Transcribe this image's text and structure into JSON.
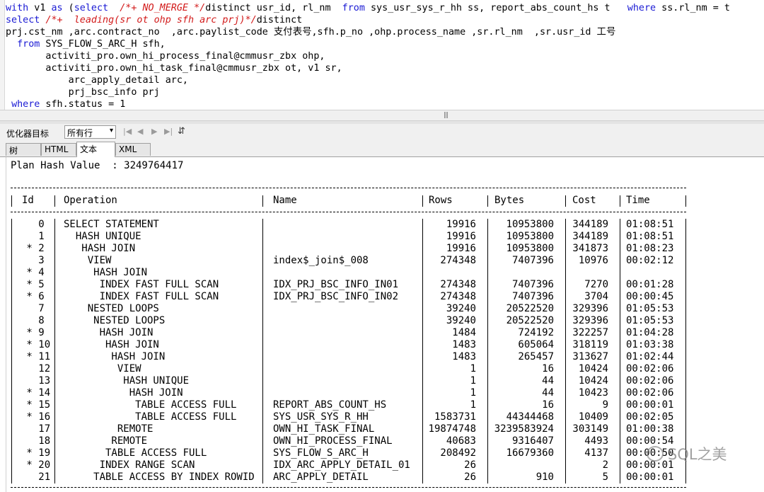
{
  "editor": {
    "lines": [
      [
        {
          "t": "with",
          "c": "kw"
        },
        {
          "t": " v1 "
        },
        {
          "t": "as",
          "c": "kw"
        },
        {
          "t": " ("
        },
        {
          "t": "select",
          "c": "kw"
        },
        {
          "t": "  "
        },
        {
          "t": "/*+ NO_MERGE */",
          "c": "cm"
        },
        {
          "t": "distinct usr_id, rl_nm  "
        },
        {
          "t": "from",
          "c": "kw"
        },
        {
          "t": " sys_usr_sys_r_hh ss, report_abs_count_hs t   "
        },
        {
          "t": "where",
          "c": "kw"
        },
        {
          "t": " ss.rl_nm = t"
        }
      ],
      [
        {
          "t": "select",
          "c": "kw"
        },
        {
          "t": " "
        },
        {
          "t": "/*+  leading(sr ot ohp sfh arc prj)*/",
          "c": "cm"
        },
        {
          "t": "distinct"
        }
      ],
      [
        {
          "t": "prj.cst_nm ,arc.contract_no  ,arc.paylist_code 支付表号,sfh.p_no ,ohp.process_name ,sr.rl_nm  ,sr.usr_id 工号"
        }
      ],
      [
        {
          "t": "  "
        },
        {
          "t": "from",
          "c": "kw"
        },
        {
          "t": " SYS_FLOW_S_ARC_H sfh,"
        }
      ],
      [
        {
          "t": "       activiti_pro.own_hi_process_final@cmmusr_zbx ohp,"
        }
      ],
      [
        {
          "t": "       activiti_pro.own_hi_task_final@cmmusr_zbx ot, v1 sr,"
        }
      ],
      [
        {
          "t": "           arc_apply_detail arc,"
        }
      ],
      [
        {
          "t": "           prj_bsc_info prj"
        }
      ],
      [
        {
          "t": " "
        },
        {
          "t": "where",
          "c": "kw"
        },
        {
          "t": " sfh.status = 1"
        }
      ]
    ]
  },
  "toolbar": {
    "optimizer_label": "优化器目标",
    "optimizer_value": "所有行",
    "nav": [
      "|◀",
      "◀",
      "▶",
      "▶|",
      "⇵"
    ]
  },
  "tabs": [
    "树",
    "HTML",
    "文本",
    "XML"
  ],
  "selected_tab": "文本",
  "plan": {
    "hash_line": "Plan Hash Value  : 3249764417",
    "headers": {
      "id": "Id",
      "operation": "Operation",
      "name": "Name",
      "rows": "Rows",
      "bytes": "Bytes",
      "cost": "Cost",
      "time": "Time"
    },
    "rows": [
      {
        "id": "   0",
        "op": "SELECT STATEMENT",
        "name": "",
        "rows": "19916",
        "bytes": "10953800",
        "cost": "344189",
        "time": "01:08:51"
      },
      {
        "id": "   1",
        "op": "  HASH UNIQUE",
        "name": "",
        "rows": "19916",
        "bytes": "10953800",
        "cost": "344189",
        "time": "01:08:51"
      },
      {
        "id": " * 2",
        "op": "   HASH JOIN",
        "name": "",
        "rows": "19916",
        "bytes": "10953800",
        "cost": "341873",
        "time": "01:08:23"
      },
      {
        "id": "   3",
        "op": "    VIEW",
        "name": "index$_join$_008",
        "rows": "274348",
        "bytes": "7407396",
        "cost": "10976",
        "time": "00:02:12"
      },
      {
        "id": " * 4",
        "op": "     HASH JOIN",
        "name": "",
        "rows": "",
        "bytes": "",
        "cost": "",
        "time": ""
      },
      {
        "id": " * 5",
        "op": "      INDEX FAST FULL SCAN",
        "name": "IDX_PRJ_BSC_INFO_IN01",
        "rows": "274348",
        "bytes": "7407396",
        "cost": "7270",
        "time": "00:01:28"
      },
      {
        "id": " * 6",
        "op": "      INDEX FAST FULL SCAN",
        "name": "IDX_PRJ_BSC_INFO_IN02",
        "rows": "274348",
        "bytes": "7407396",
        "cost": "3704",
        "time": "00:00:45"
      },
      {
        "id": "   7",
        "op": "    NESTED LOOPS",
        "name": "",
        "rows": "39240",
        "bytes": "20522520",
        "cost": "329396",
        "time": "01:05:53"
      },
      {
        "id": "   8",
        "op": "     NESTED LOOPS",
        "name": "",
        "rows": "39240",
        "bytes": "20522520",
        "cost": "329396",
        "time": "01:05:53"
      },
      {
        "id": " * 9",
        "op": "      HASH JOIN",
        "name": "",
        "rows": "1484",
        "bytes": "724192",
        "cost": "322257",
        "time": "01:04:28"
      },
      {
        "id": " * 10",
        "op": "       HASH JOIN",
        "name": "",
        "rows": "1483",
        "bytes": "605064",
        "cost": "318119",
        "time": "01:03:38"
      },
      {
        "id": " * 11",
        "op": "        HASH JOIN",
        "name": "",
        "rows": "1483",
        "bytes": "265457",
        "cost": "313627",
        "time": "01:02:44"
      },
      {
        "id": "   12",
        "op": "         VIEW",
        "name": "",
        "rows": "1",
        "bytes": "16",
        "cost": "10424",
        "time": "00:02:06"
      },
      {
        "id": "   13",
        "op": "          HASH UNIQUE",
        "name": "",
        "rows": "1",
        "bytes": "44",
        "cost": "10424",
        "time": "00:02:06"
      },
      {
        "id": " * 14",
        "op": "           HASH JOIN",
        "name": "",
        "rows": "1",
        "bytes": "44",
        "cost": "10423",
        "time": "00:02:06"
      },
      {
        "id": " * 15",
        "op": "            TABLE ACCESS FULL",
        "name": "REPORT_ABS_COUNT_HS",
        "rows": "1",
        "bytes": "16",
        "cost": "9",
        "time": "00:00:01"
      },
      {
        "id": " * 16",
        "op": "            TABLE ACCESS FULL",
        "name": "SYS_USR_SYS_R_HH",
        "rows": "1583731",
        "bytes": "44344468",
        "cost": "10409",
        "time": "00:02:05"
      },
      {
        "id": "   17",
        "op": "         REMOTE",
        "name": "OWN_HI_TASK_FINAL",
        "rows": "19874748",
        "bytes": "3239583924",
        "cost": "303149",
        "time": "01:00:38"
      },
      {
        "id": "   18",
        "op": "        REMOTE",
        "name": "OWN_HI_PROCESS_FINAL",
        "rows": "40683",
        "bytes": "9316407",
        "cost": "4493",
        "time": "00:00:54"
      },
      {
        "id": " * 19",
        "op": "       TABLE ACCESS FULL",
        "name": "SYS_FLOW_S_ARC_H",
        "rows": "208492",
        "bytes": "16679360",
        "cost": "4137",
        "time": "00:00:50"
      },
      {
        "id": " * 20",
        "op": "      INDEX RANGE SCAN",
        "name": "IDX_ARC_APPLY_DETAIL_01",
        "rows": "26",
        "bytes": "",
        "cost": "2",
        "time": "00:00:01"
      },
      {
        "id": "   21",
        "op": "     TABLE ACCESS BY INDEX ROWID",
        "name": "ARC_APPLY_DETAIL",
        "rows": "26",
        "bytes": "910",
        "cost": "5",
        "time": "00:00:01"
      }
    ]
  },
  "watermark": "SQL之美"
}
